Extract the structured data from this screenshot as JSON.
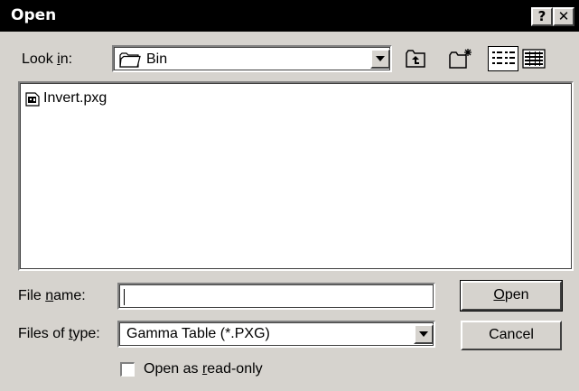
{
  "window": {
    "title": "Open",
    "help_label": "?",
    "close_label": "✕"
  },
  "look_in": {
    "label_pre": "Look ",
    "label_key": "i",
    "label_post": "n:",
    "value": "Bin",
    "icon": "folder-icon"
  },
  "toolbar": {
    "up_icon": "up-one-level-icon",
    "new_folder_icon": "create-new-folder-icon",
    "list_icon": "list-view-icon",
    "details_icon": "details-view-icon"
  },
  "files": [
    {
      "name": "Invert.pxg",
      "icon": "pxg-file-icon"
    }
  ],
  "file_name": {
    "label_pre": "File ",
    "label_key": "n",
    "label_post": "ame:",
    "value": ""
  },
  "file_type": {
    "label_pre": "Files of ",
    "label_key": "t",
    "label_post": "ype:",
    "value": "Gamma Table (*.PXG)"
  },
  "buttons": {
    "open_key": "O",
    "open_rest": "pen",
    "cancel": "Cancel"
  },
  "read_only": {
    "label_pre": "Open as ",
    "label_key": "r",
    "label_post": "ead-only",
    "checked": false
  }
}
